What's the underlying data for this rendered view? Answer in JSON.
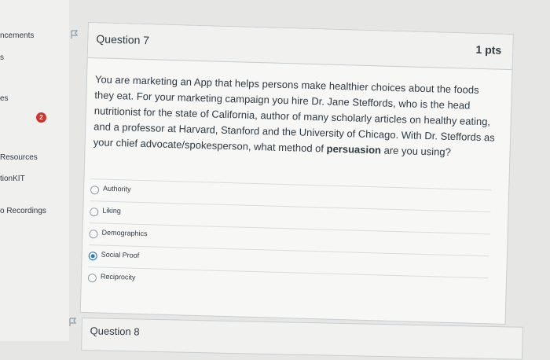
{
  "sidebar": {
    "items": [
      {
        "label": "ncements"
      },
      {
        "label": "s"
      },
      {
        "label": "es"
      },
      {
        "label": "Resources"
      },
      {
        "label": "tionKIT"
      },
      {
        "label": "o Recordings"
      }
    ],
    "badge": "2"
  },
  "question7": {
    "title": "Question 7",
    "points": "1 pts",
    "text": "You are marketing an App that helps persons make healthier choices about the foods they eat. For your marketing campaign you hire Dr. Jane Steffords, who is the head nutritionist for the state of California, author of many scholarly articles on healthy eating, and a professor at Harvard, Stanford and the University of Chicago. With Dr. Steffords as your chief advocate/spokesperson, what method of ",
    "text_bold": "persuasion",
    "text_end": " are you using?",
    "answers": [
      {
        "label": "Authority",
        "selected": false
      },
      {
        "label": "Liking",
        "selected": false
      },
      {
        "label": "Demographics",
        "selected": false
      },
      {
        "label": "Social Proof",
        "selected": true
      },
      {
        "label": "Reciprocity",
        "selected": false
      }
    ]
  },
  "question8": {
    "title": "Question 8"
  }
}
